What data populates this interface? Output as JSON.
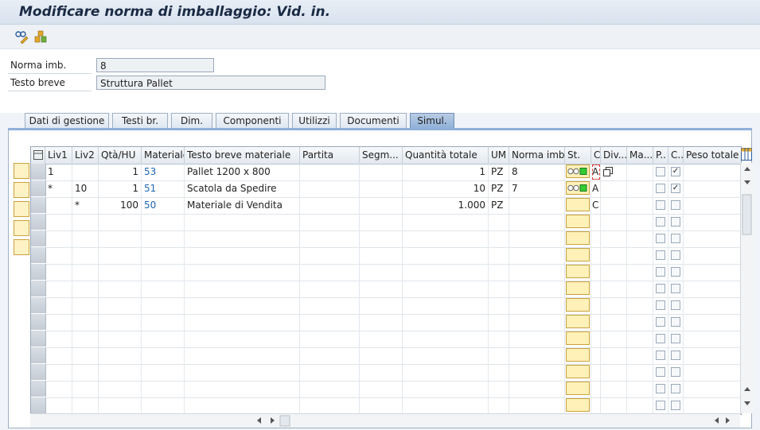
{
  "title": "Modificare norma di imballaggio: Vid. in.",
  "toolbar": {
    "icons": [
      "display-change-icon",
      "object-links-icon"
    ]
  },
  "form": {
    "norma_label": "Norma imb.",
    "norma_value": "8",
    "testo_label": "Testo breve",
    "testo_value": "Struttura Pallet"
  },
  "tabs": [
    {
      "label": "Dati di gestione"
    },
    {
      "label": "Testi br."
    },
    {
      "label": "Dim."
    },
    {
      "label": "Componenti"
    },
    {
      "label": "Utilizzi"
    },
    {
      "label": "Documenti"
    },
    {
      "label": "Simul."
    }
  ],
  "active_tab": "Simul.",
  "grid": {
    "headers": [
      "Liv1",
      "Liv2",
      "Qtà/HU",
      "Materiale",
      "Testo breve materiale",
      "Partita",
      "Segm...",
      "Quantità totale",
      "UM",
      "Norma imb.",
      "St.",
      "C",
      "Div...",
      "Ma...",
      "P..",
      "C..",
      "Peso totale"
    ],
    "rows": [
      {
        "liv1": "1",
        "liv2": "",
        "qta": "1",
        "materiale": "53",
        "testo": "Pallet 1200 x 800",
        "partita": "",
        "segm": "",
        "quantita": "1",
        "um": "PZ",
        "norma": "8",
        "c": "A",
        "c2_checked": true
      },
      {
        "liv1": "*",
        "liv2": "10",
        "qta": "1",
        "materiale": "51",
        "testo": "Scatola da Spedire",
        "partita": "",
        "segm": "",
        "quantita": "10",
        "um": "PZ",
        "norma": "7",
        "c": "A",
        "c2_checked": true
      },
      {
        "liv1": "",
        "liv2": "*",
        "qta": "100",
        "materiale": "50",
        "testo": "Materiale di Vendita",
        "partita": "",
        "segm": "",
        "quantita": "1.000",
        "um": "PZ",
        "norma": "",
        "c": "C",
        "c2_checked": false
      }
    ]
  }
}
